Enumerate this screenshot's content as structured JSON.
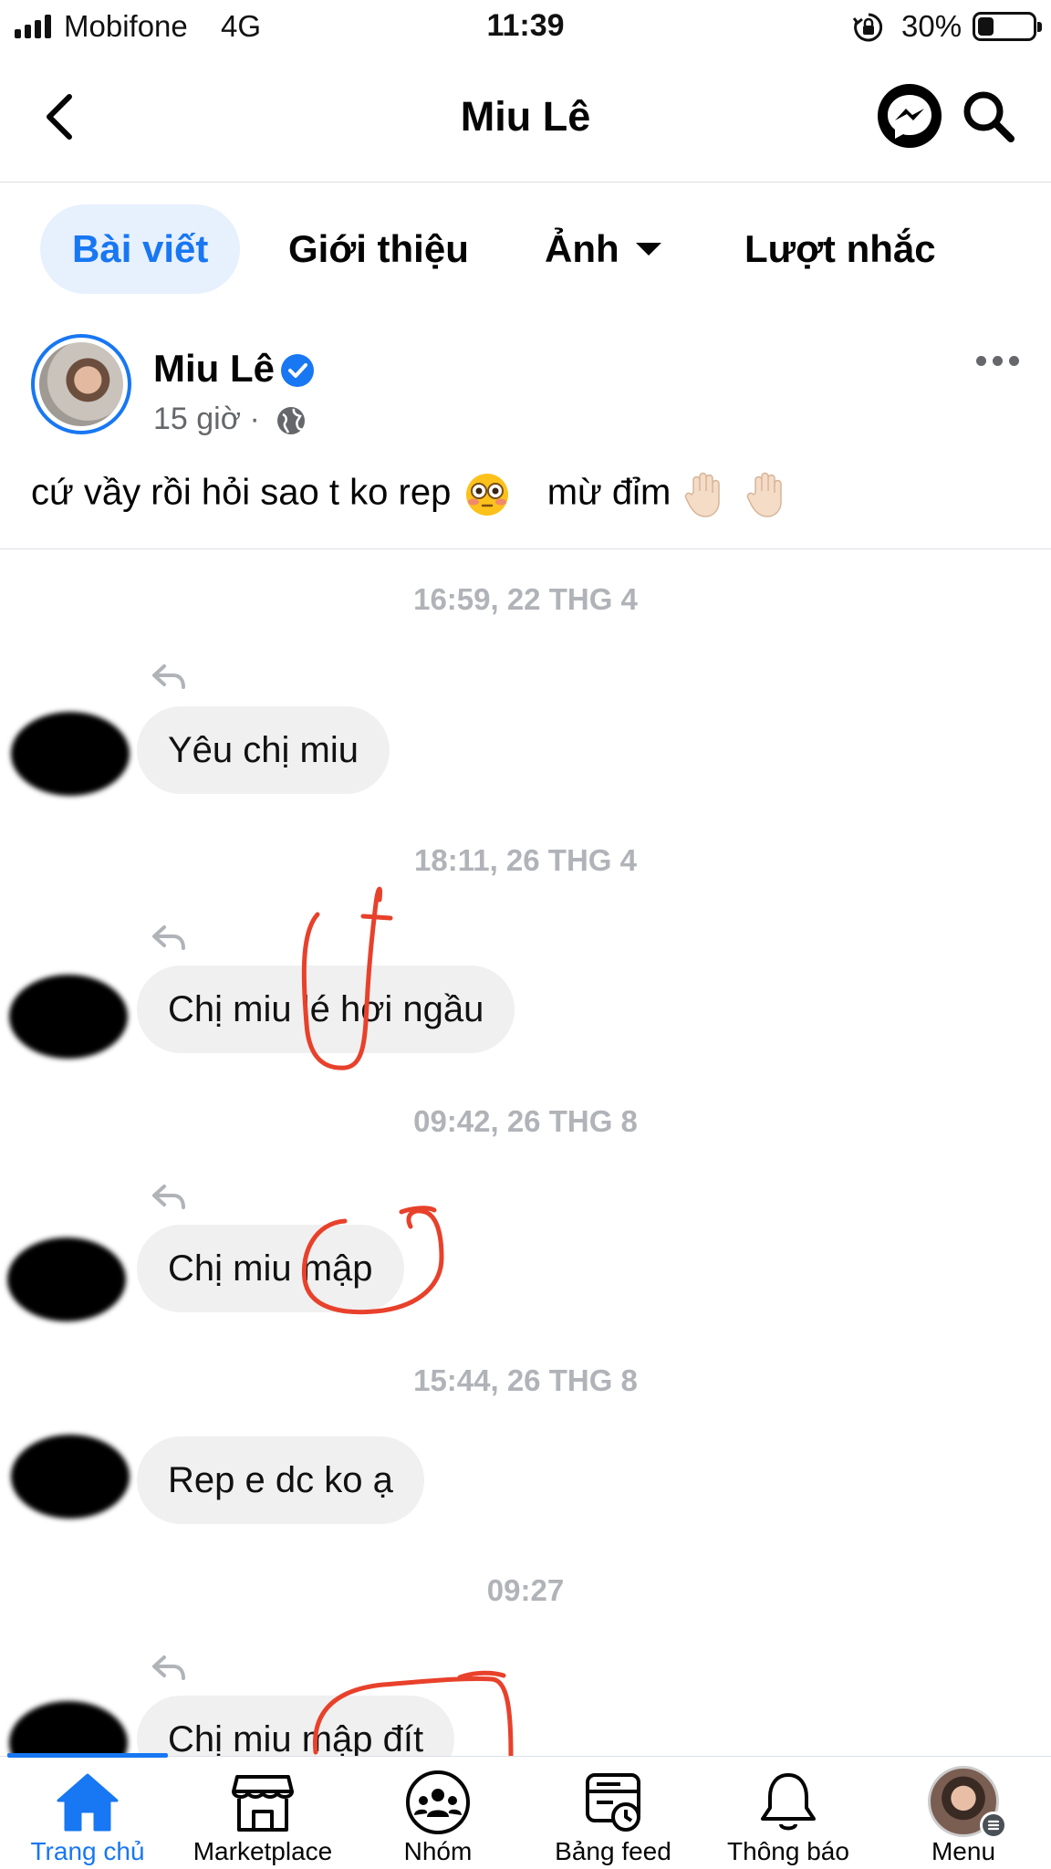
{
  "status_bar": {
    "carrier": "Mobifone",
    "network": "4G",
    "time": "11:39",
    "battery_percent": "30%",
    "battery_level": 0.3
  },
  "header": {
    "title": "Miu Lê",
    "icons": [
      "back-icon",
      "messenger-icon",
      "search-icon"
    ]
  },
  "tabs": [
    {
      "label": "Bài viết",
      "active": true
    },
    {
      "label": "Giới thiệu",
      "active": false
    },
    {
      "label": "Ảnh",
      "active": false
    },
    {
      "label": "Lượt nhắc",
      "active": false
    }
  ],
  "post": {
    "author": "Miu Lê",
    "time": "15 giờ ·",
    "text_part1": "cứ vầy rồi hỏi sao t ko rep",
    "text_part2": "mừ đỉm",
    "emojis": [
      "flushed-face-emoji",
      "raised-hand-emoji",
      "raised-hand-emoji"
    ]
  },
  "chat": {
    "messages": [
      {
        "timestamp": "16:59, 22 THG 4",
        "text": "Yêu chị miu"
      },
      {
        "timestamp": "18:11, 26 THG 4",
        "text": "Chị miu lé hơi ngầu"
      },
      {
        "timestamp": "09:42, 26 THG 8",
        "text": "Chị miu mập"
      },
      {
        "timestamp": "15:44, 26 THG 8",
        "text": "Rep e dc ko ạ"
      },
      {
        "timestamp": "09:27",
        "text": "Chị miu mập đít"
      }
    ]
  },
  "bottom_nav": [
    {
      "label": "Trang chủ",
      "icon": "home-icon",
      "active": true
    },
    {
      "label": "Marketplace",
      "icon": "marketplace-icon",
      "active": false
    },
    {
      "label": "Nhóm",
      "icon": "groups-icon",
      "active": false
    },
    {
      "label": "Bảng feed",
      "icon": "feed-icon",
      "active": false
    },
    {
      "label": "Thông báo",
      "icon": "bell-icon",
      "active": false
    },
    {
      "label": "Menu",
      "icon": "menu-avatar",
      "active": false
    }
  ],
  "colors": {
    "accent": "#1877f2",
    "annotation": "#e8412b",
    "bubble": "#f0f0f0",
    "timestamp": "#b0b3b8"
  }
}
